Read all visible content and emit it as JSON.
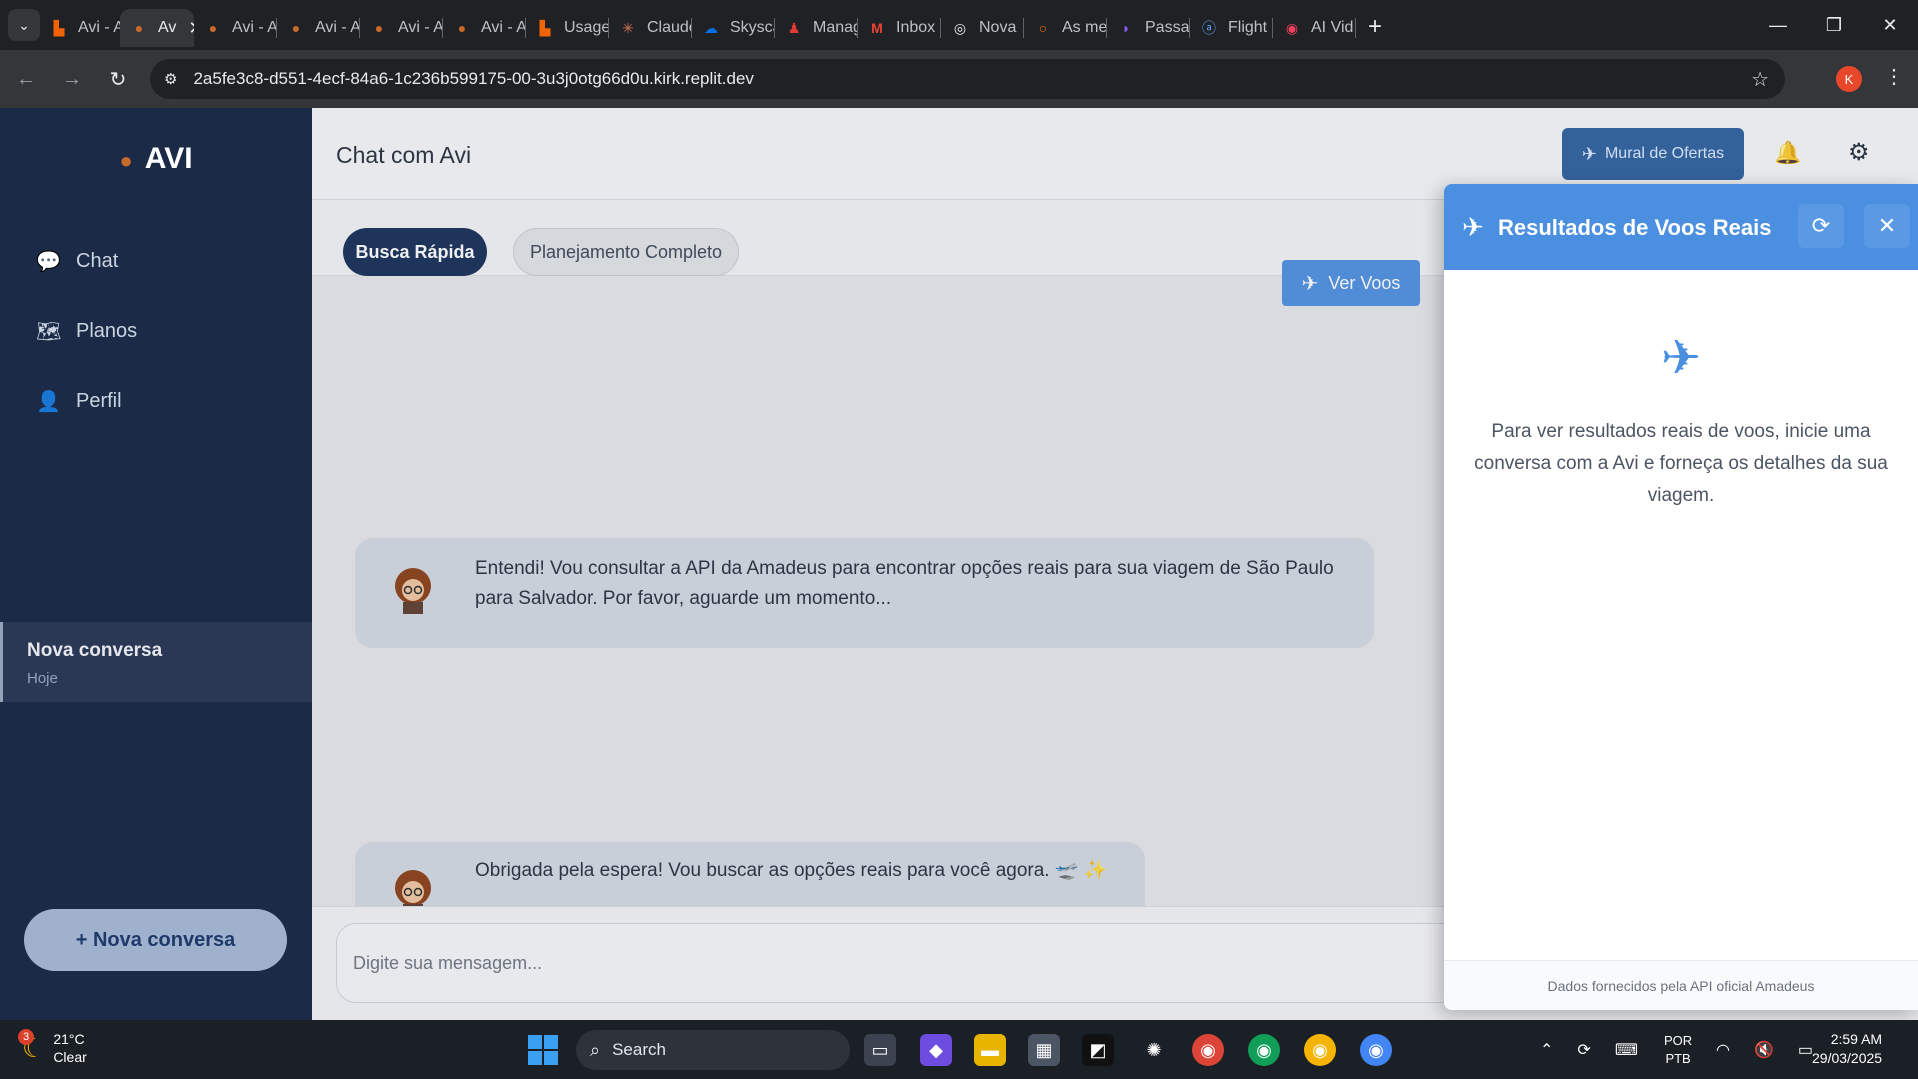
{
  "browser": {
    "tabs": [
      {
        "label": "Avi - A",
        "icon": "replit-icon"
      },
      {
        "label": "Av",
        "icon": "avi-icon",
        "active": true
      },
      {
        "label": "Avi - A",
        "icon": "avi-icon"
      },
      {
        "label": "Avi - A",
        "icon": "avi-icon"
      },
      {
        "label": "Avi - A",
        "icon": "avi-icon"
      },
      {
        "label": "Avi - A",
        "icon": "avi-icon"
      },
      {
        "label": "Usage",
        "icon": "replit-icon"
      },
      {
        "label": "Claude",
        "icon": "claude-icon"
      },
      {
        "label": "Skysca",
        "icon": "skyscanner-icon"
      },
      {
        "label": "Manag",
        "icon": "manage-icon"
      },
      {
        "label": "Inbox",
        "icon": "gmail-icon"
      },
      {
        "label": "Nova",
        "icon": "chatgpt-icon"
      },
      {
        "label": "As me",
        "icon": "circle-icon"
      },
      {
        "label": "Passa",
        "icon": "passa-icon"
      },
      {
        "label": "Flight",
        "icon": "amadeus-icon"
      },
      {
        "label": "AI Vid",
        "icon": "ai-video-icon"
      }
    ],
    "url": "2a5fe3c8-d551-4ecf-84a6-1c236b599175-00-3u3j0otg66d0u.kirk.replit.dev",
    "profile_initial": "K"
  },
  "sidebar": {
    "brand": "AVI",
    "nav": [
      {
        "label": "Chat",
        "icon": "chat-icon"
      },
      {
        "label": "Planos",
        "icon": "map-icon"
      },
      {
        "label": "Perfil",
        "icon": "user-icon"
      }
    ],
    "conversation": {
      "title": "Nova conversa",
      "date": "Hoje"
    },
    "new_conversation_label": "+ Nova conversa"
  },
  "header": {
    "title": "Chat com Avi",
    "mural_label": "Mural de Ofertas"
  },
  "modes": {
    "quick": "Busca Rápida",
    "full": "Planejamento Completo"
  },
  "ver_voos_label": "Ver Voos",
  "messages": [
    {
      "text": "Entendi! Vou consultar a API da Amadeus para encontrar opções reais para sua viagem de São Paulo para Salvador. Por favor, aguarde um momento..."
    },
    {
      "text": "Obrigada pela espera! Vou buscar as opções reais para você agora. 🛫 ✨"
    }
  ],
  "composer": {
    "placeholder": "Digite sua mensagem..."
  },
  "flight_panel": {
    "title": "Resultados de Voos Reais",
    "empty_text": "Para ver resultados reais de voos, inicie uma conversa com a Avi e forneça os detalhes da sua viagem.",
    "footer": "Dados fornecidos pela API oficial Amadeus"
  },
  "taskbar": {
    "weather_badge": "3",
    "temperature": "21°C",
    "condition": "Clear",
    "search_label": "Search",
    "lang_1": "POR",
    "lang_2": "PTB",
    "time": "2:59 AM",
    "date": "29/03/2025"
  },
  "colors": {
    "sidebar_bg": "#1b2a47",
    "accent_blue": "#4a8fe0",
    "mural_btn": "#2a5e9c",
    "active_mode": "#132a52"
  }
}
